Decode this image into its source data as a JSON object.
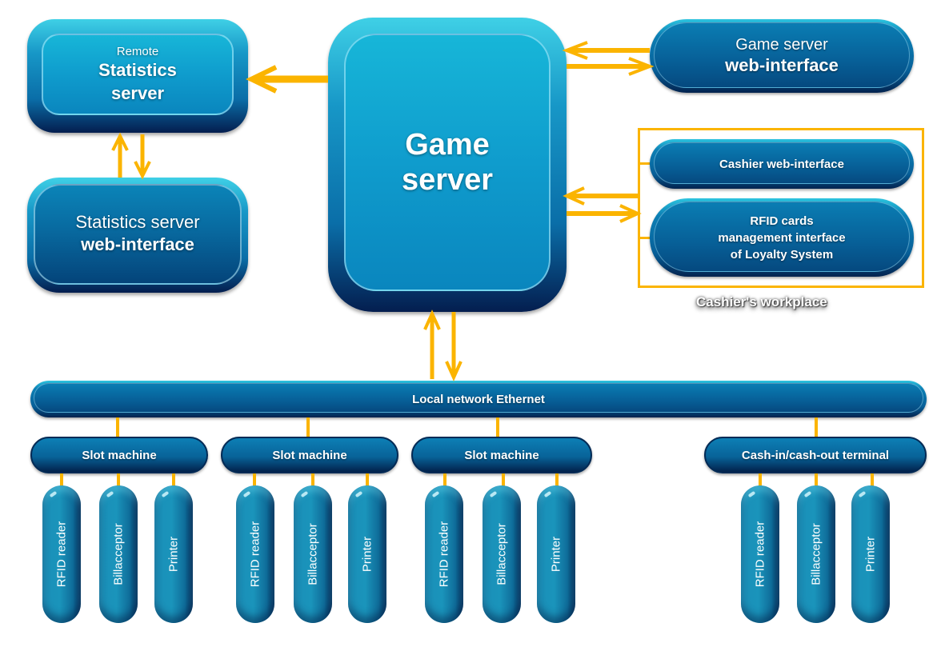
{
  "diagram": {
    "colors": {
      "connector": "#fbb400",
      "box_light": "#12a8d4",
      "box_dark": "#086aa0",
      "frame_edge": "#041e4f"
    },
    "remote_stats_server": {
      "line1": "Remote",
      "line2": "Statistics",
      "line3": "server"
    },
    "stats_web_interface": {
      "line1": "Statistics server",
      "line2": "web-interface"
    },
    "game_server": {
      "line1": "Game",
      "line2": "server"
    },
    "game_web_interface": {
      "line1": "Game server",
      "line2": "web-interface"
    },
    "cashier_workplace": {
      "label": "Cashier's workplace",
      "cashier_web_interface": "Cashier web-interface",
      "rfid_management": {
        "line1": "RFID cards",
        "line2": "management interface",
        "line3": "of Loyalty System"
      }
    },
    "ethernet": {
      "label": "Local network Ethernet"
    },
    "terminals": [
      {
        "label": "Slot machine",
        "devices": [
          "RFID reader",
          "Billacceptor",
          "Printer"
        ]
      },
      {
        "label": "Slot machine",
        "devices": [
          "RFID reader",
          "Billacceptor",
          "Printer"
        ]
      },
      {
        "label": "Slot machine",
        "devices": [
          "RFID reader",
          "Billacceptor",
          "Printer"
        ]
      },
      {
        "label": "Cash-in/cash-out terminal",
        "devices": [
          "RFID reader",
          "Billacceptor",
          "Printer"
        ]
      }
    ]
  }
}
